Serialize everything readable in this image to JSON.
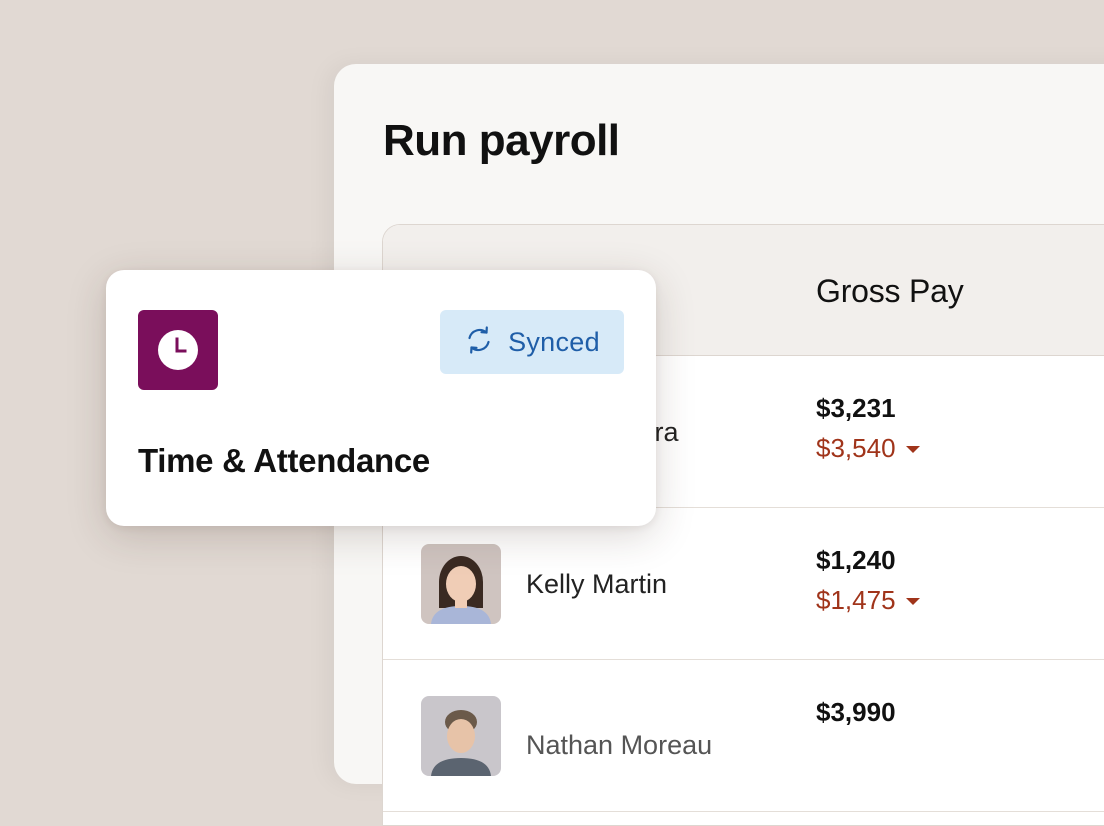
{
  "page": {
    "title": "Run payroll"
  },
  "table": {
    "gross_pay_header": "Gross Pay",
    "rows": [
      {
        "name": "veira",
        "gross_pay": "$3,231",
        "adjusted_pay": "$3,540"
      },
      {
        "name": "Kelly Martin",
        "gross_pay": "$1,240",
        "adjusted_pay": "$1,475"
      },
      {
        "name": "Nathan Moreau",
        "gross_pay": "$3,990",
        "adjusted_pay": ""
      }
    ]
  },
  "integration_card": {
    "title": "Time & Attendance",
    "status": "Synced",
    "icon": "clock-icon",
    "status_icon": "sync-icon"
  },
  "colors": {
    "background": "#e1d9d3",
    "app_icon": "#7a0e5b",
    "badge_bg": "#d7eaf8",
    "badge_text": "#1f5ea8",
    "adjusted_pay": "#a0341a"
  }
}
